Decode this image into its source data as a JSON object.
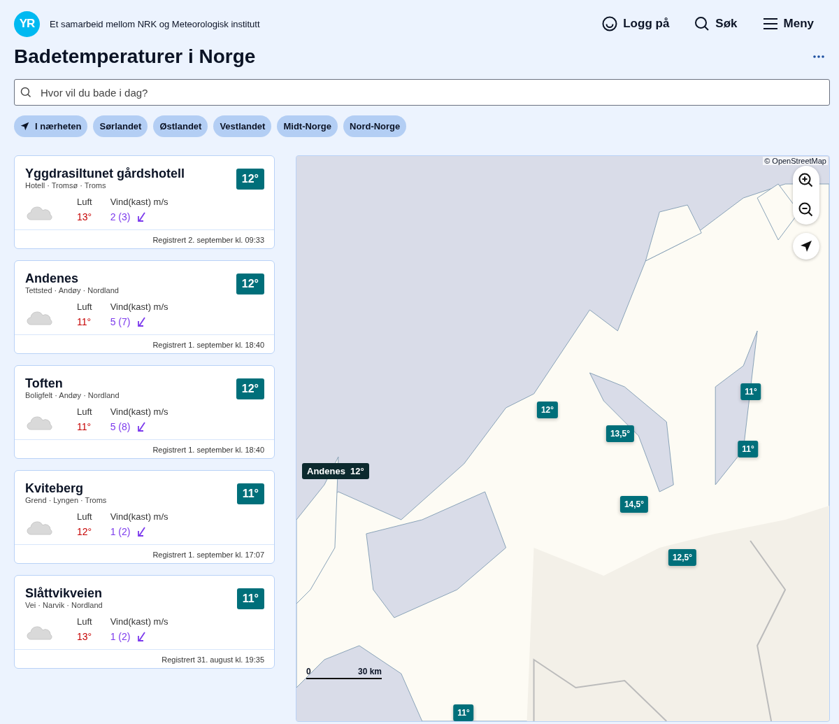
{
  "header": {
    "logo": "YR",
    "tagline": "Et samarbeid mellom NRK og Meteorologisk institutt",
    "actions": [
      {
        "kind": "login",
        "label": "Logg på"
      },
      {
        "kind": "search",
        "label": "Søk"
      },
      {
        "kind": "menu",
        "label": "Meny"
      }
    ]
  },
  "title": "Badetemperaturer i Norge",
  "search": {
    "placeholder": "Hvor vil du bade i dag?"
  },
  "regions": [
    {
      "kind": "nearby",
      "label": "I nærheten"
    },
    {
      "kind": "region",
      "label": "Sørlandet"
    },
    {
      "kind": "region",
      "label": "Østlandet"
    },
    {
      "kind": "region",
      "label": "Vestlandet"
    },
    {
      "kind": "region",
      "label": "Midt-Norge"
    },
    {
      "kind": "region",
      "label": "Nord-Norge"
    }
  ],
  "places": [
    {
      "name": "Yggdrasiltunet gårdshotell",
      "subtitle": "Hotell · Tromsø · Troms",
      "water_temp": "12°",
      "air_label": "Luft",
      "air_temp": "13°",
      "wind_label": "Vind(kast) m/s",
      "wind": "2 (3)",
      "registered": "Registrert 2. september kl. 09:33"
    },
    {
      "name": "Andenes",
      "subtitle": "Tettsted · Andøy · Nordland",
      "water_temp": "12°",
      "air_label": "Luft",
      "air_temp": "11°",
      "wind_label": "Vind(kast) m/s",
      "wind": "5 (7)",
      "registered": "Registrert 1. september kl. 18:40"
    },
    {
      "name": "Toften",
      "subtitle": "Boligfelt · Andøy · Nordland",
      "water_temp": "12°",
      "air_label": "Luft",
      "air_temp": "11°",
      "wind_label": "Vind(kast) m/s",
      "wind": "5 (8)",
      "registered": "Registrert 1. september kl. 18:40"
    },
    {
      "name": "Kviteberg",
      "subtitle": "Grend · Lyngen · Troms",
      "water_temp": "11°",
      "air_label": "Luft",
      "air_temp": "12°",
      "wind_label": "Vind(kast) m/s",
      "wind": "1 (2)",
      "registered": "Registrert 1. september kl. 17:07"
    },
    {
      "name": "Slåttvikveien",
      "subtitle": "Vei · Narvik · Nordland",
      "water_temp": "11°",
      "air_label": "Luft",
      "air_temp": "13°",
      "wind_label": "Vind(kast) m/s",
      "wind": "1 (2)",
      "registered": "Registrert 31. august kl. 19:35"
    }
  ],
  "map": {
    "attribution": "© OpenStreetMap",
    "markers": [
      {
        "label": "11°"
      },
      {
        "label": "12°"
      },
      {
        "label": "13,5°"
      },
      {
        "label": "11°"
      },
      {
        "label": "14,5°"
      },
      {
        "label": "12,5°"
      },
      {
        "label": "11°"
      }
    ],
    "tooltip": {
      "name": "Andenes",
      "temp": "12°"
    },
    "scale": {
      "start": "0",
      "end": "30 km"
    }
  }
}
